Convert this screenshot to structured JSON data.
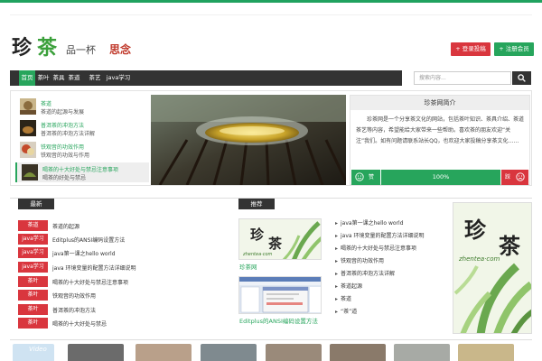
{
  "header": {
    "logo_char1": "珍",
    "logo_char2": "茶",
    "tagline1": "品一杯",
    "tagline2": "思念",
    "btn_red": "+ 登录投稿",
    "btn_green": "+ 注册会员",
    "accent": "#27a55c",
    "accent_red": "#d9363e"
  },
  "nav": {
    "items": [
      "首页",
      "茶叶",
      "茶具",
      "茶道",
      "茶艺",
      "java学习"
    ],
    "active_index": 0,
    "search_placeholder": "搜索内容..."
  },
  "feature": {
    "posts": [
      {
        "title": "茶道",
        "subtitle": "茶道的起源与发展"
      },
      {
        "title": "普洱茶的冲泡方法",
        "subtitle": "普洱茶的冲泡方法详解"
      },
      {
        "title": "铁观音的功效作用",
        "subtitle": "铁观音的功效与作用"
      },
      {
        "title": "喝茶的十大好处与禁忌注意事项",
        "subtitle": "喝茶的好处与禁忌"
      }
    ],
    "active_post": 3,
    "intro_title": "珍茶网简介",
    "intro_text": "珍茶网是一个分享茶文化的网站，包括茶叶知识、茶具介绍、茶道茶艺等内容，希望能给大家带来一些帮助。喜欢茶的朋友欢迎“关注”我们。如有问题请联系站长QQ，也欢迎大家投稿分享茶文化……",
    "vote_percent": "100%",
    "vote_up": "赞",
    "vote_down": "踩"
  },
  "lower": {
    "left_tab": "最新",
    "mid_tab": "推荐",
    "list": [
      {
        "tag": "茶道",
        "text": "茶道的起源"
      },
      {
        "tag": "java学习",
        "text": "Editplus的ANSI编码设置方法"
      },
      {
        "tag": "java学习",
        "text": "java第一课之hello world"
      },
      {
        "tag": "java学习",
        "text": "java 环境变量的配置方法详细说明"
      },
      {
        "tag": "茶叶",
        "text": "喝茶的十大好处与禁忌注意事项"
      },
      {
        "tag": "茶叶",
        "text": "铁观音的功效作用"
      },
      {
        "tag": "茶叶",
        "text": "普洱茶的冲泡方法"
      },
      {
        "tag": "茶叶",
        "text": "喝茶的十大好处与禁忌"
      }
    ],
    "mid_images": [
      {
        "caption": "珍茶网",
        "logo1": "珍",
        "logo2": "茶",
        "url": "zhentea·com"
      },
      {
        "caption": "Editplus的ANSI编码设置方法"
      }
    ],
    "right_list": [
      "java第一课之hello world",
      "java 环境变量的配置方法详细说明",
      "喝茶的十大好处与禁忌注意事项",
      "铁观音的功效作用",
      "普洱茶的冲泡方法详解",
      "茶道起源",
      "茶道",
      "“茶”道"
    ],
    "side_logo1": "珍",
    "side_logo2": "茶",
    "side_url": "zhentea·com"
  },
  "strip": {
    "video_label": "Video"
  }
}
